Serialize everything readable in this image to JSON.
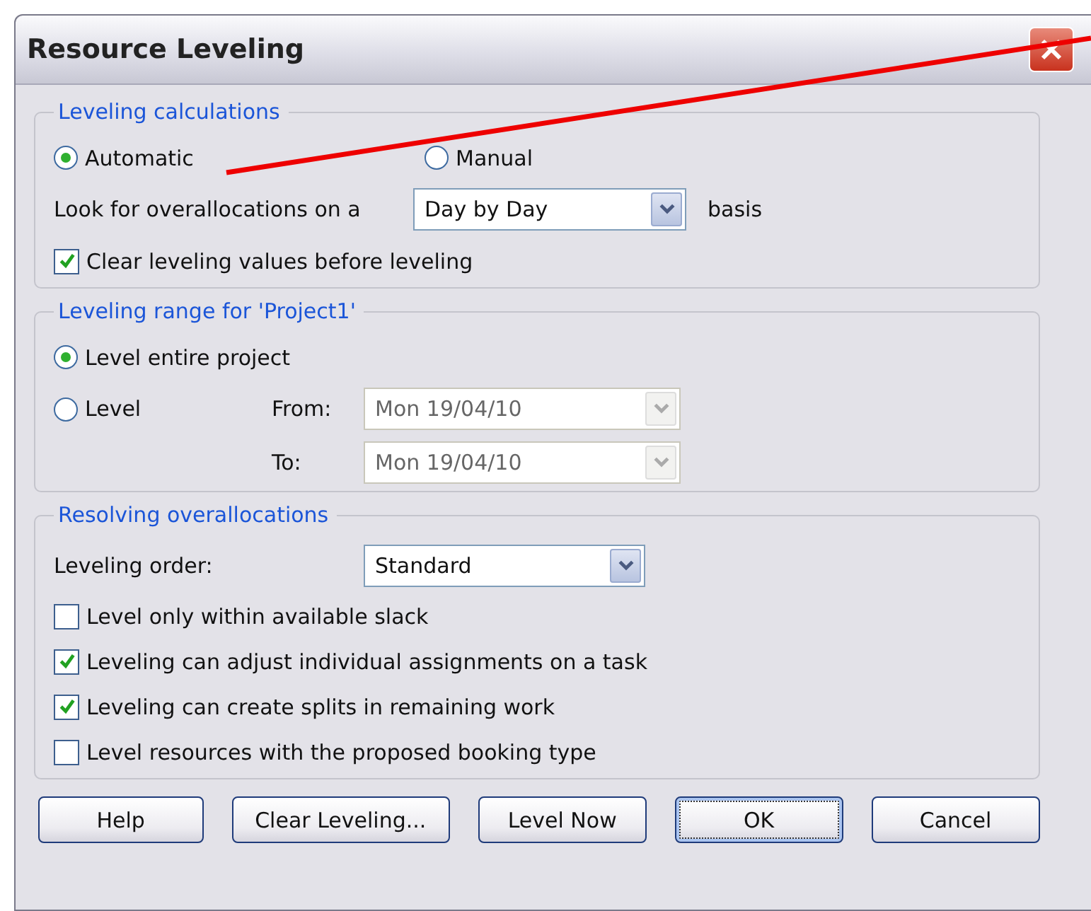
{
  "window": {
    "title": "Resource Leveling"
  },
  "leveling_calculations": {
    "legend": "Leveling calculations",
    "modes": [
      {
        "label": "Automatic",
        "selected": true
      },
      {
        "label": "Manual",
        "selected": false
      }
    ],
    "overallocation_label": "Look for overallocations on a",
    "basis": {
      "value": "Day by Day",
      "disabled": false
    },
    "basis_suffix": "basis",
    "clear_values": {
      "label": "Clear leveling values before leveling",
      "checked": true
    }
  },
  "leveling_range": {
    "legend": "Leveling range for 'Project1'",
    "options": [
      {
        "label": "Level entire project",
        "selected": true
      },
      {
        "label": "Level",
        "selected": false
      }
    ],
    "from_label": "From:",
    "from": {
      "value": "Mon 19/04/10",
      "disabled": true
    },
    "to_label": "To:",
    "to": {
      "value": "Mon 19/04/10",
      "disabled": true
    }
  },
  "resolving_overallocations": {
    "legend": "Resolving overallocations",
    "order_label": "Leveling order:",
    "order": {
      "value": "Standard",
      "disabled": false
    },
    "options": [
      {
        "label": "Level only within available slack",
        "checked": false
      },
      {
        "label": "Leveling can adjust individual assignments on a task",
        "checked": true
      },
      {
        "label": "Leveling can create splits in remaining work",
        "checked": true
      },
      {
        "label": "Level resources with the proposed booking type",
        "checked": false
      }
    ]
  },
  "buttons": [
    {
      "label": "Help",
      "focused": false
    },
    {
      "label": "Clear Leveling...",
      "focused": false
    },
    {
      "label": "Level Now",
      "focused": false
    },
    {
      "label": "OK",
      "focused": true
    },
    {
      "label": "Cancel",
      "focused": false
    }
  ]
}
